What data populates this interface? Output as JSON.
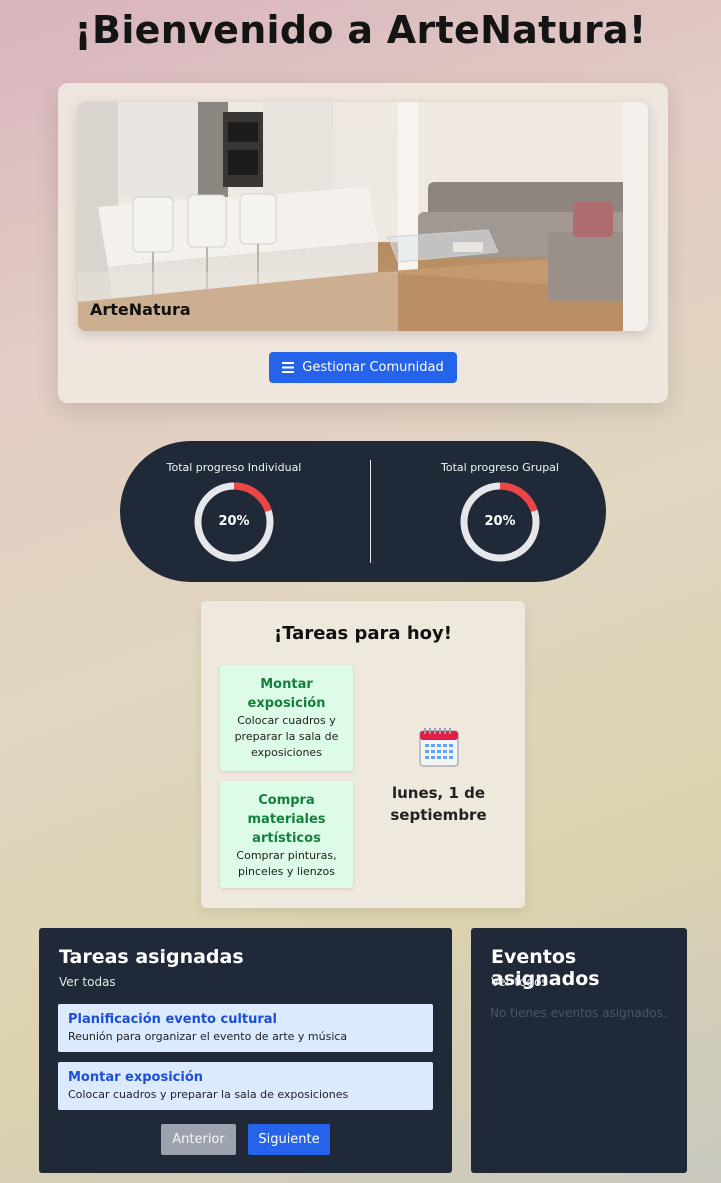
{
  "header": {
    "title": "¡Bienvenido a ArteNatura!"
  },
  "hero": {
    "image_label": "ArteNatura",
    "manage_button": {
      "icon": "menu-icon",
      "label": "Gestionar Comunidad"
    }
  },
  "progress": {
    "individual": {
      "label": "Total progreso Individual",
      "value": 20,
      "value_text": "20%"
    },
    "group": {
      "label": "Total progreso Grupal",
      "value": 20,
      "value_text": "20%"
    },
    "colors": {
      "track": "#e5e7eb",
      "fill": "#ef4444"
    }
  },
  "today": {
    "title": "¡Tareas para hoy!",
    "tasks": [
      {
        "title": "Montar exposición",
        "desc": "Colocar cuadros y preparar la sala de exposiciones"
      },
      {
        "title": "Compra materiales artísticos",
        "desc": "Comprar pinturas, pinceles y lienzos"
      }
    ],
    "calendar_icon": "calendar-icon",
    "date": "lunes, 1 de septiembre"
  },
  "assigned_tasks": {
    "title": "Tareas asignadas",
    "link": "Ver todas",
    "items": [
      {
        "title": "Planificación evento cultural",
        "desc": "Reunión para organizar el evento de arte y música"
      },
      {
        "title": "Montar exposición",
        "desc": "Colocar cuadros y preparar la sala de exposiciones"
      }
    ],
    "prev_label": "Anterior",
    "next_label": "Siguiente"
  },
  "assigned_events": {
    "title": "Eventos asignados",
    "link": "Ver todos",
    "empty_text": "No tienes eventos asignados."
  }
}
